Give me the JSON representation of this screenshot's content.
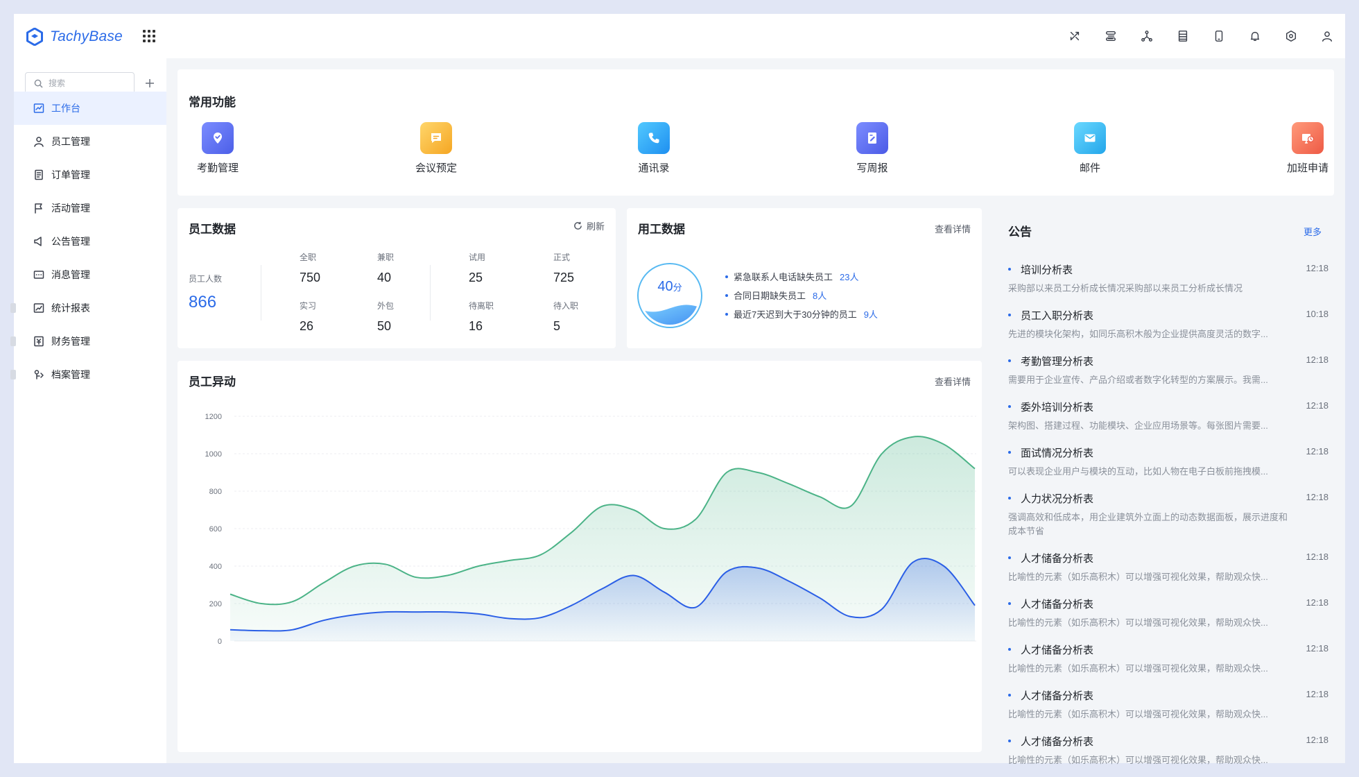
{
  "app": {
    "name": "TachyBase"
  },
  "header": {
    "icons": [
      "tools-icon",
      "layers-icon",
      "network-icon",
      "database-icon",
      "mobile-icon",
      "bell-icon",
      "settings-icon",
      "user-icon"
    ]
  },
  "sidebar": {
    "search_placeholder": "搜索",
    "items": [
      {
        "label": "工作台",
        "icon": "dashboard-icon",
        "active": true
      },
      {
        "label": "员工管理",
        "icon": "person-icon"
      },
      {
        "label": "订单管理",
        "icon": "order-icon"
      },
      {
        "label": "活动管理",
        "icon": "flag-icon"
      },
      {
        "label": "公告管理",
        "icon": "megaphone-icon"
      },
      {
        "label": "消息管理",
        "icon": "message-icon"
      },
      {
        "label": "统计报表",
        "icon": "chart-icon"
      },
      {
        "label": "财务管理",
        "icon": "finance-icon"
      },
      {
        "label": "档案管理",
        "icon": "archive-icon"
      }
    ]
  },
  "quick": {
    "title": "常用功能",
    "items": [
      {
        "label": "考勤管理",
        "icon": "attendance-icon",
        "color": "#5b6cf0"
      },
      {
        "label": "会议预定",
        "icon": "meeting-icon",
        "color": "#f7b23b"
      },
      {
        "label": "通讯录",
        "icon": "phone-icon",
        "color": "#2aa6f0"
      },
      {
        "label": "写周报",
        "icon": "report-icon",
        "color": "#5a6cf2"
      },
      {
        "label": "邮件",
        "icon": "mail-icon",
        "color": "#35b8ef"
      },
      {
        "label": "加班申请",
        "icon": "overtime-icon",
        "color": "#f2735a"
      }
    ]
  },
  "employee": {
    "title": "员工数据",
    "refresh": "刷新",
    "total_label": "员工人数",
    "total": "866",
    "stats": [
      {
        "label": "全职",
        "value": "750"
      },
      {
        "label": "兼职",
        "value": "40"
      },
      {
        "label": "试用",
        "value": "25"
      },
      {
        "label": "正式",
        "value": "725"
      },
      {
        "label": "实习",
        "value": "26"
      },
      {
        "label": "外包",
        "value": "50"
      },
      {
        "label": "待离职",
        "value": "16"
      },
      {
        "label": "待入职",
        "value": "5"
      }
    ]
  },
  "usage": {
    "title": "用工数据",
    "link": "查看详情",
    "score": "40",
    "score_unit": "分",
    "score_pct": 40,
    "items": [
      {
        "label": "紧急联系人电话缺失员工",
        "count": "23人"
      },
      {
        "label": "合同日期缺失员工",
        "count": "8人"
      },
      {
        "label": "最近7天迟到大于30分钟的员工",
        "count": "9人"
      }
    ]
  },
  "changes": {
    "title": "员工异动",
    "link": "查看详情"
  },
  "chart_data": {
    "type": "area",
    "title": "员工异动",
    "ylim": [
      0,
      1200
    ],
    "yticks": [
      0,
      200,
      400,
      600,
      800,
      1000,
      1200
    ],
    "grid": true,
    "series": [
      {
        "color": "#4bb387",
        "values": [
          250,
          200,
          210,
          310,
          400,
          410,
          340,
          350,
          400,
          430,
          460,
          580,
          720,
          700,
          600,
          650,
          900,
          900,
          840,
          770,
          720,
          1000,
          1090,
          1050,
          920
        ]
      },
      {
        "color": "#2b5fe6",
        "values": [
          60,
          55,
          60,
          110,
          140,
          155,
          155,
          155,
          145,
          120,
          125,
          190,
          280,
          350,
          260,
          180,
          370,
          390,
          320,
          230,
          130,
          170,
          420,
          400,
          190
        ]
      }
    ]
  },
  "notices": {
    "title": "公告",
    "more": "更多",
    "items": [
      {
        "title": "培训分析表",
        "time": "12:18",
        "desc": "采购部以来员工分析成长情况采购部以来员工分析成长情况"
      },
      {
        "title": "员工入职分析表",
        "time": "10:18",
        "desc": "先进的模块化架构，如同乐高积木般为企业提供高度灵活的数字..."
      },
      {
        "title": "考勤管理分析表",
        "time": "12:18",
        "desc": "需要用于企业宣传、产品介绍或者数字化转型的方案展示。我需..."
      },
      {
        "title": "委外培训分析表",
        "time": "12:18",
        "desc": "架构图、搭建过程、功能模块、企业应用场景等。每张图片需要..."
      },
      {
        "title": "面试情况分析表",
        "time": "12:18",
        "desc": "可以表现企业用户与模块的互动，比如人物在电子白板前拖拽模..."
      },
      {
        "title": "人力状况分析表",
        "time": "12:18",
        "desc": "强调高效和低成本，用企业建筑外立面上的动态数据面板，展示进度和成本节省"
      },
      {
        "title": "人才储备分析表",
        "time": "12:18",
        "desc": "比喻性的元素（如乐高积木）可以增强可视化效果，帮助观众快..."
      },
      {
        "title": "人才储备分析表",
        "time": "12:18",
        "desc": "比喻性的元素（如乐高积木）可以增强可视化效果，帮助观众快..."
      },
      {
        "title": "人才储备分析表",
        "time": "12:18",
        "desc": "比喻性的元素（如乐高积木）可以增强可视化效果，帮助观众快..."
      },
      {
        "title": "人才储备分析表",
        "time": "12:18",
        "desc": "比喻性的元素（如乐高积木）可以增强可视化效果，帮助观众快..."
      },
      {
        "title": "人才储备分析表",
        "time": "12:18",
        "desc": "比喻性的元素（如乐高积木）可以增强可视化效果，帮助观众快..."
      }
    ]
  }
}
